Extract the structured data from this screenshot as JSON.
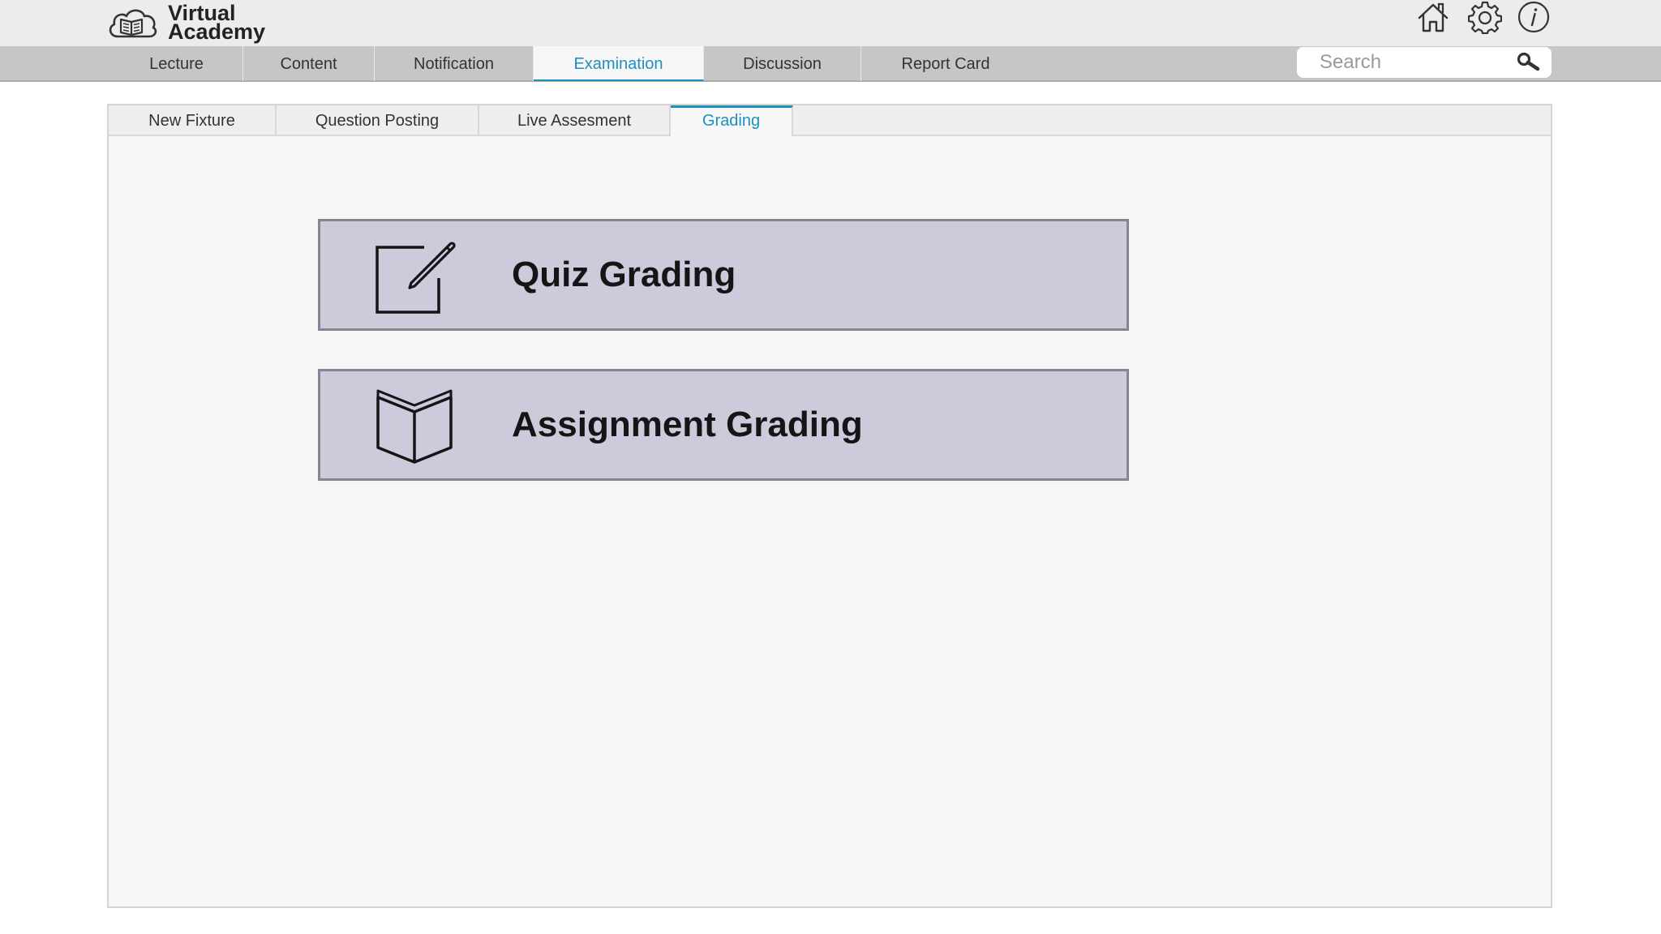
{
  "app": {
    "name_line1": "Virtual",
    "name_line2": "Academy",
    "logo_icon": "cloud-book-icon"
  },
  "header_icons": [
    "home-icon",
    "gear-icon",
    "info-icon"
  ],
  "nav": {
    "tabs": [
      {
        "label": "Lecture",
        "active": false
      },
      {
        "label": "Content",
        "active": false
      },
      {
        "label": "Notification",
        "active": false
      },
      {
        "label": "Examination",
        "active": true
      },
      {
        "label": "Discussion",
        "active": false
      },
      {
        "label": "Report Card",
        "active": false
      }
    ]
  },
  "search": {
    "placeholder": "Search",
    "value": ""
  },
  "subtabs": [
    {
      "label": "New Fixture",
      "active": false
    },
    {
      "label": "Question Posting",
      "active": false
    },
    {
      "label": "Live Assesment",
      "active": false
    },
    {
      "label": "Grading",
      "active": true
    }
  ],
  "cards": [
    {
      "label": "Quiz Grading",
      "icon": "edit-note-icon"
    },
    {
      "label": "Assignment Grading",
      "icon": "open-book-icon"
    }
  ],
  "colors": {
    "accent": "#1f8fbf",
    "card_bg": "#cdcadb",
    "card_border": "#87858f",
    "nav_bg": "#c6c6c6"
  }
}
